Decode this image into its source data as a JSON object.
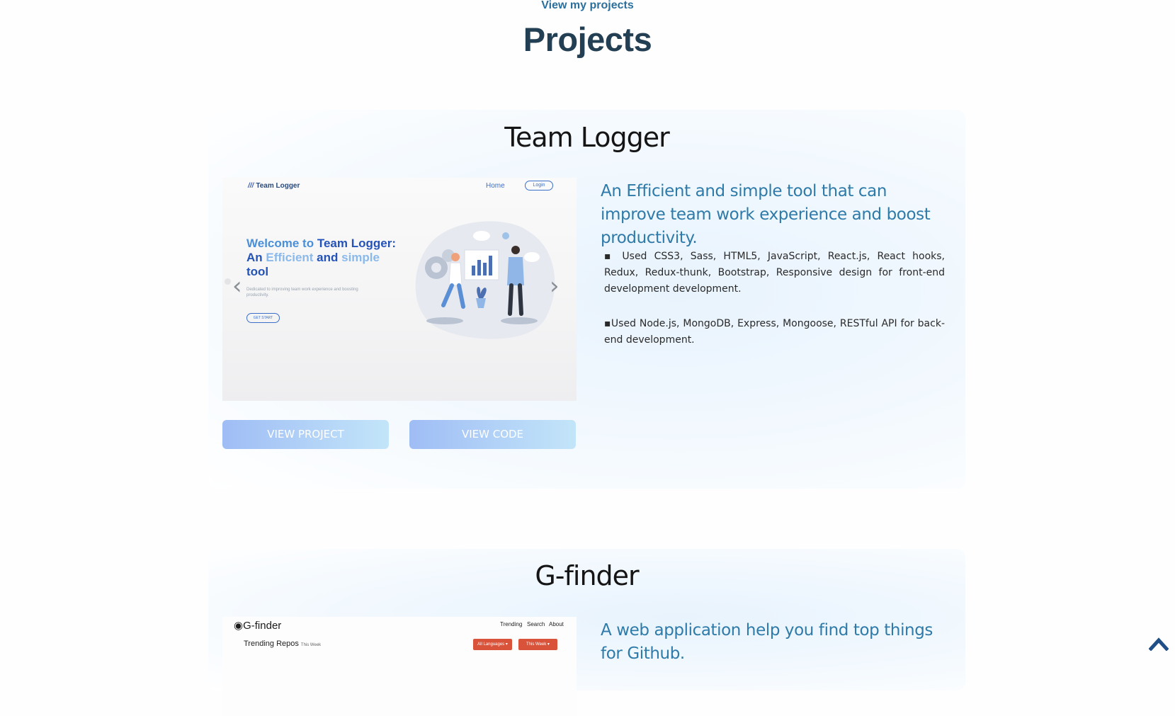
{
  "top_link": "View my projects",
  "section_title": "Projects",
  "projects": [
    {
      "title": "Team Logger",
      "screenshot": {
        "brand": "Team Logger",
        "nav_home": "Home",
        "nav_login": "Login",
        "hero_prefix": "Welcome to ",
        "hero_brand": "Team Logger",
        "hero_colon": ":",
        "hero_an": "An ",
        "hero_efficient": "Efficient",
        "hero_and": " and ",
        "hero_simple": "simple",
        "hero_tool": "tool",
        "hero_sub": "Dedicated to improving team work experience and boosting productivity.",
        "hero_button": "GET START"
      },
      "description": "An Efficient and simple tool that can improve team work experience and boost productivity.",
      "bullets": [
        "▪ Used CSS3, Sass, HTML5, JavaScript, React.js, React hooks, Redux, Redux-thunk, Bootstrap, Responsive design for front-end development development.",
        "▪Used Node.js, MongoDB, Express, Mongoose, RESTful API for back-end development."
      ],
      "view_project_label": "VIEW PROJECT",
      "view_code_label": "VIEW CODE",
      "carousel_prev": "‹",
      "carousel_next": "›"
    },
    {
      "title": "G-finder",
      "screenshot": {
        "logo": "G-finder",
        "nav_trending": "Trending",
        "nav_search": "Search",
        "nav_about": "About",
        "heading": "Trending Repos",
        "heading_small": "This Week",
        "filter_language": "All Languages ▾",
        "filter_period": "This Week ▾"
      },
      "description": "A web application help you find top things for Github."
    }
  ],
  "colors": {
    "accent": "#2e7aa8",
    "title": "#233f53",
    "button_start": "#9fbdf5",
    "button_end": "#c3e5f9",
    "scroll_top": "#1f4f86"
  },
  "icons": {
    "scroll_top": "chevron-up-icon",
    "carousel_prev": "chevron-left-icon",
    "carousel_next": "chevron-right-icon",
    "github": "github-icon"
  }
}
